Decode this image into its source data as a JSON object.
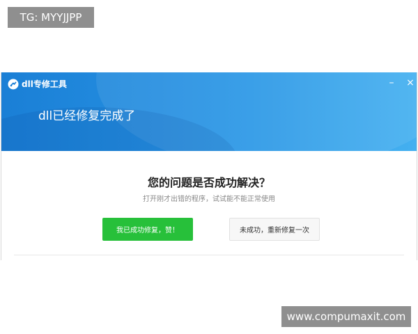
{
  "watermarks": {
    "top_left": "TG: MYYJJPP",
    "bottom_right": "www.compumaxit.com"
  },
  "window": {
    "title": "dll专修工具",
    "header_message": "dll已经修复完成了",
    "controls": {
      "minimize": "–",
      "close": "×"
    },
    "accent_color": "#1a7fd6"
  },
  "content": {
    "question": "您的问题是否成功解决？",
    "hint": "打开刚才出错的程序，试试能不能正常使用",
    "buttons": {
      "success_label": "我已成功修复，赞！",
      "success_color": "#27c03a",
      "fail_label": "未成功，重新修复一次"
    }
  }
}
